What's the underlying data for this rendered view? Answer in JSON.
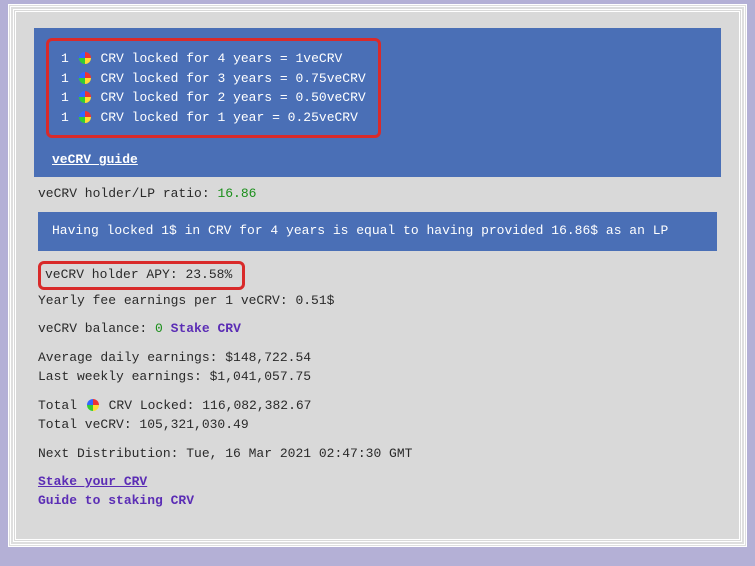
{
  "lock_rules": [
    {
      "prefix": "1",
      "token": "CRV",
      "text": "locked for 4 years = 1veCRV"
    },
    {
      "prefix": "1",
      "token": "CRV",
      "text": "locked for 3 years = 0.75veCRV"
    },
    {
      "prefix": "1",
      "token": "CRV",
      "text": "locked for 2 years = 0.50veCRV"
    },
    {
      "prefix": "1",
      "token": "CRV",
      "text": "locked for 1 year = 0.25veCRV"
    }
  ],
  "guide_link": "veCRV guide",
  "ratio": {
    "label": "veCRV holder/LP ratio: ",
    "value": "16.86"
  },
  "banner": "Having locked 1$ in CRV for 4 years is equal to having provided 16.86$ as an LP",
  "apy": {
    "label": "veCRV holder APY: ",
    "value": "23.58%"
  },
  "yearly_fee": "Yearly fee earnings per 1 veCRV: 0.51$",
  "balance": {
    "label": "veCRV balance: ",
    "value": "0",
    "link": "Stake CRV"
  },
  "avg_daily": "Average daily earnings: $148,722.54",
  "last_weekly": "Last weekly earnings: $1,041,057.75",
  "total_locked": {
    "prefix": "Total ",
    "token": "CRV",
    "rest": "Locked: 116,082,382.67"
  },
  "total_vecrv": "Total veCRV: 105,321,030.49",
  "next_dist": "Next Distribution: Tue, 16 Mar 2021 02:47:30 GMT",
  "stake_link": "Stake your CRV",
  "guide_staking": "Guide to staking CRV"
}
